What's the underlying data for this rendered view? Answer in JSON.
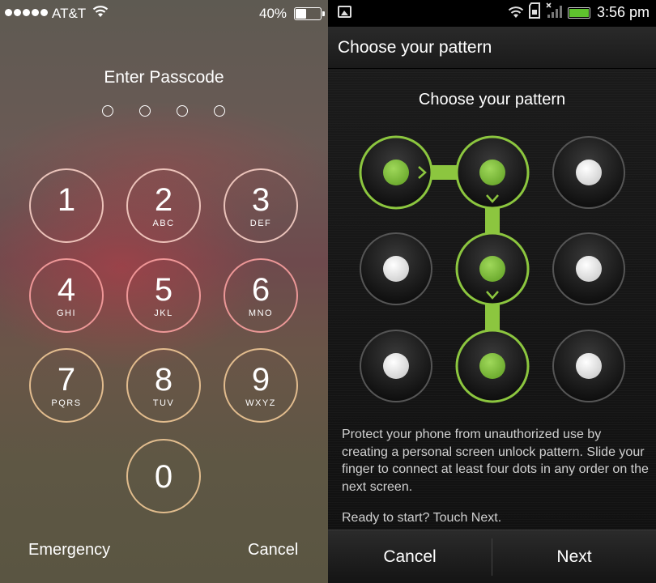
{
  "ios": {
    "status": {
      "carrier": "AT&T",
      "battery": "40%",
      "battery_level": 0.4
    },
    "title": "Enter Passcode",
    "keys": [
      {
        "num": "1",
        "letters": ""
      },
      {
        "num": "2",
        "letters": "ABC"
      },
      {
        "num": "3",
        "letters": "DEF"
      },
      {
        "num": "4",
        "letters": "GHI"
      },
      {
        "num": "5",
        "letters": "JKL"
      },
      {
        "num": "6",
        "letters": "MNO"
      },
      {
        "num": "7",
        "letters": "PQRS"
      },
      {
        "num": "8",
        "letters": "TUV"
      },
      {
        "num": "9",
        "letters": "WXYZ"
      },
      {
        "num": "0",
        "letters": ""
      }
    ],
    "emergency_label": "Emergency",
    "cancel_label": "Cancel"
  },
  "android": {
    "status": {
      "time": "3:56 pm"
    },
    "header_title": "Choose your pattern",
    "subtitle": "Choose your pattern",
    "description": "Protect your phone from unauthorized use by creating a personal screen unlock pattern. Slide your finger to connect at least four dots in any order on the next screen.",
    "ready_text": "Ready to start? Touch Next.",
    "cancel_label": "Cancel",
    "next_label": "Next",
    "pattern_selected": [
      1,
      2,
      5,
      8
    ],
    "accent_color": "#8cc63f"
  }
}
